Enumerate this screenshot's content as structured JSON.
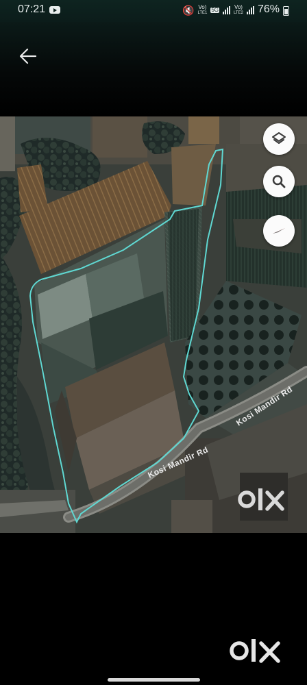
{
  "status_bar": {
    "time": "07:21",
    "battery_percent": "76%",
    "network_label_1": "Vo)",
    "network_sub_1": "LTE1",
    "network_label_2": "Vo)",
    "network_sub_2": "LTE2",
    "network_badge": "5G"
  },
  "app_bar": {
    "back_icon": "arrow-left-icon"
  },
  "map": {
    "road_labels": [
      "Kosi Mandir Rd",
      "Kosi Mandir Rd"
    ],
    "controls": [
      {
        "name": "layers",
        "icon": "layers-icon"
      },
      {
        "name": "search",
        "icon": "search-icon"
      },
      {
        "name": "compass",
        "icon": "compass-icon"
      }
    ],
    "boundary_color": "#5fd8d2",
    "watermark": "OLX"
  },
  "footer": {
    "watermark": "OLX"
  }
}
